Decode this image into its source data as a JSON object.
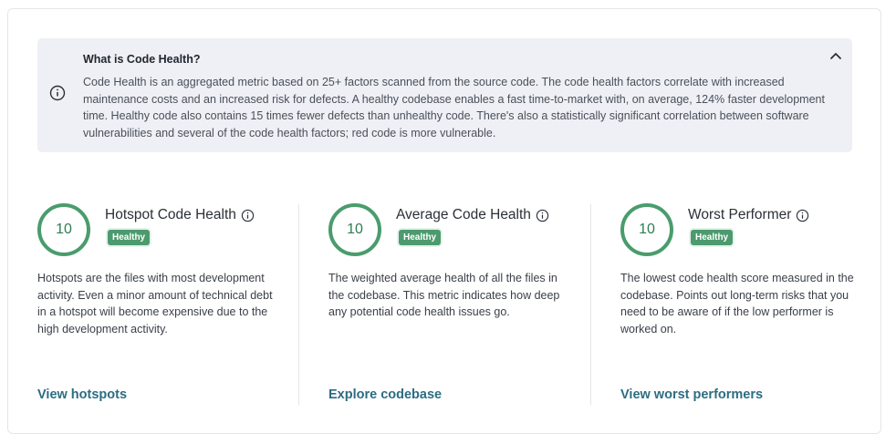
{
  "info": {
    "title": "What is Code Health?",
    "body": "Code Health is an aggregated metric based on 25+ factors scanned from the source code. The code health factors correlate with increased maintenance costs and an increased risk for defects. A healthy codebase enables a fast time-to-market with, on average, 124% faster development time. Healthy code also contains 15 times fewer defects than unhealthy code. There's also a statistically significant correlation between software vulnerabilities and several of the code health factors; red code is more vulnerable.",
    "icons": {
      "info": "info-circle-icon",
      "collapse": "chevron-up-icon"
    }
  },
  "metrics": [
    {
      "score": "10",
      "title": "Hotspot Code Health",
      "badge": "Healthy",
      "description": "Hotspots are the files with most development activity. Even a minor amount of technical debt in a hotspot will become expensive due to the high development activity.",
      "link": "View hotspots"
    },
    {
      "score": "10",
      "title": "Average Code Health",
      "badge": "Healthy",
      "description": "The weighted average health of all the files in the codebase. This metric indicates how deep any potential code health issues go.",
      "link": "Explore codebase"
    },
    {
      "score": "10",
      "title": "Worst Performer",
      "badge": "Healthy",
      "description": "The lowest code health score measured in the codebase. Points out long-term risks that you need to be aware of if the low performer is worked on.",
      "link": "View worst performers"
    }
  ],
  "colors": {
    "healthy": "#4c9a6e",
    "link": "#2c6d82",
    "info_bg": "#eef0f5"
  }
}
